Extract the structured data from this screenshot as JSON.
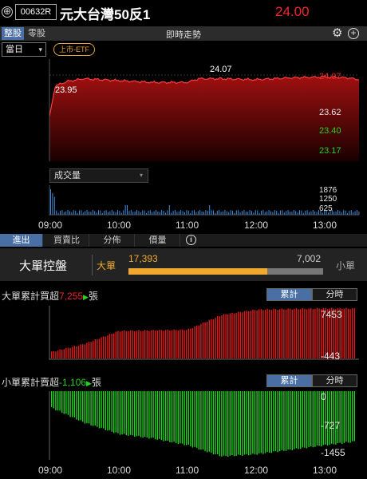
{
  "header": {
    "add_symbol": "⊕",
    "stock_code": "00632R",
    "stock_name": "元大台灣50反1",
    "price": "24.00",
    "price_color": "#f3262a"
  },
  "tabbar": {
    "tabs": [
      {
        "label": "整股"
      },
      {
        "label": "零股"
      }
    ],
    "title": "即時走勢",
    "settings_icon": "⚙",
    "add_icon": "+"
  },
  "controls": {
    "period_value": "當日",
    "period_chevron": "▾",
    "etf_badge": "上市-ETF"
  },
  "price_chart": {
    "y_ticks": [
      {
        "label": "24.07",
        "color": "#f3262a"
      },
      {
        "label": "23.62",
        "color": "#e6e6e6"
      },
      {
        "label": "23.40",
        "color": "#22d322"
      },
      {
        "label": "23.17",
        "color": "#22d322"
      }
    ],
    "high_label": "24.07",
    "low_label": "23.95"
  },
  "volume_chart": {
    "selector": "成交量",
    "selector_chevron": "▾",
    "y_ticks": [
      "1876",
      "1250",
      "625"
    ]
  },
  "time_axis": [
    "09:00",
    "10:00",
    "11:00",
    "12:00",
    "13:00"
  ],
  "analysis_tabs": [
    {
      "label": "進出"
    },
    {
      "label": "買賣比"
    },
    {
      "label": "分佈"
    },
    {
      "label": "價量"
    }
  ],
  "info_icon": "i",
  "control_panel": {
    "title": "大單控盤",
    "big_label": "大單",
    "small_label": "小單",
    "big_value": "17,393",
    "small_value": "7,002",
    "big_ratio": 0.713
  },
  "big_order": {
    "label_prefix": "大單累計買超",
    "value": "7,255",
    "unit": "張",
    "seg_cumulative": "累計",
    "seg_time": "分時",
    "y_ticks": [
      "7453",
      "-443"
    ]
  },
  "small_order": {
    "label_prefix": "小單累計賣超",
    "value": "-1,106",
    "unit": "張",
    "seg_cumulative": "累計",
    "seg_time": "分時",
    "y_ticks": [
      "0",
      "-727",
      "-1455"
    ]
  },
  "chart_data": [
    {
      "type": "area",
      "title": "",
      "ylim": [
        23.17,
        24.07
      ],
      "y_ticks": [
        24.07,
        23.62,
        23.4,
        23.17
      ],
      "x": [
        "09:00",
        "09:05",
        "09:15",
        "09:30",
        "10:00",
        "10:30",
        "11:00",
        "11:10",
        "11:30",
        "12:00",
        "12:30",
        "13:00",
        "13:20",
        "13:30"
      ],
      "values": [
        23.62,
        23.95,
        24.0,
        24.03,
        24.01,
        23.99,
        23.99,
        24.03,
        24.03,
        24.02,
        24.04,
        24.05,
        24.04,
        24.02
      ]
    },
    {
      "type": "bar",
      "title": "成交量",
      "ylim": [
        0,
        1876
      ],
      "y_ticks": [
        1876,
        1250,
        625
      ]
    },
    {
      "type": "bar",
      "title": "大單累計買超",
      "ylim": [
        -443,
        7453
      ],
      "x": [
        "09:00",
        "09:30",
        "10:00",
        "10:30",
        "11:00",
        "11:30",
        "12:00",
        "12:30",
        "13:00",
        "13:30"
      ],
      "values": [
        500,
        1800,
        3800,
        3900,
        4000,
        6300,
        7100,
        7200,
        7300,
        7255
      ]
    },
    {
      "type": "bar",
      "title": "小單累計賣超",
      "ylim": [
        -1455,
        0
      ],
      "x": [
        "09:00",
        "09:30",
        "10:00",
        "10:30",
        "11:00",
        "11:30",
        "12:00",
        "12:30",
        "13:00",
        "13:30"
      ],
      "values": [
        -350,
        -700,
        -950,
        -1050,
        -1200,
        -1450,
        -1400,
        -1300,
        -1200,
        -1106
      ]
    }
  ]
}
